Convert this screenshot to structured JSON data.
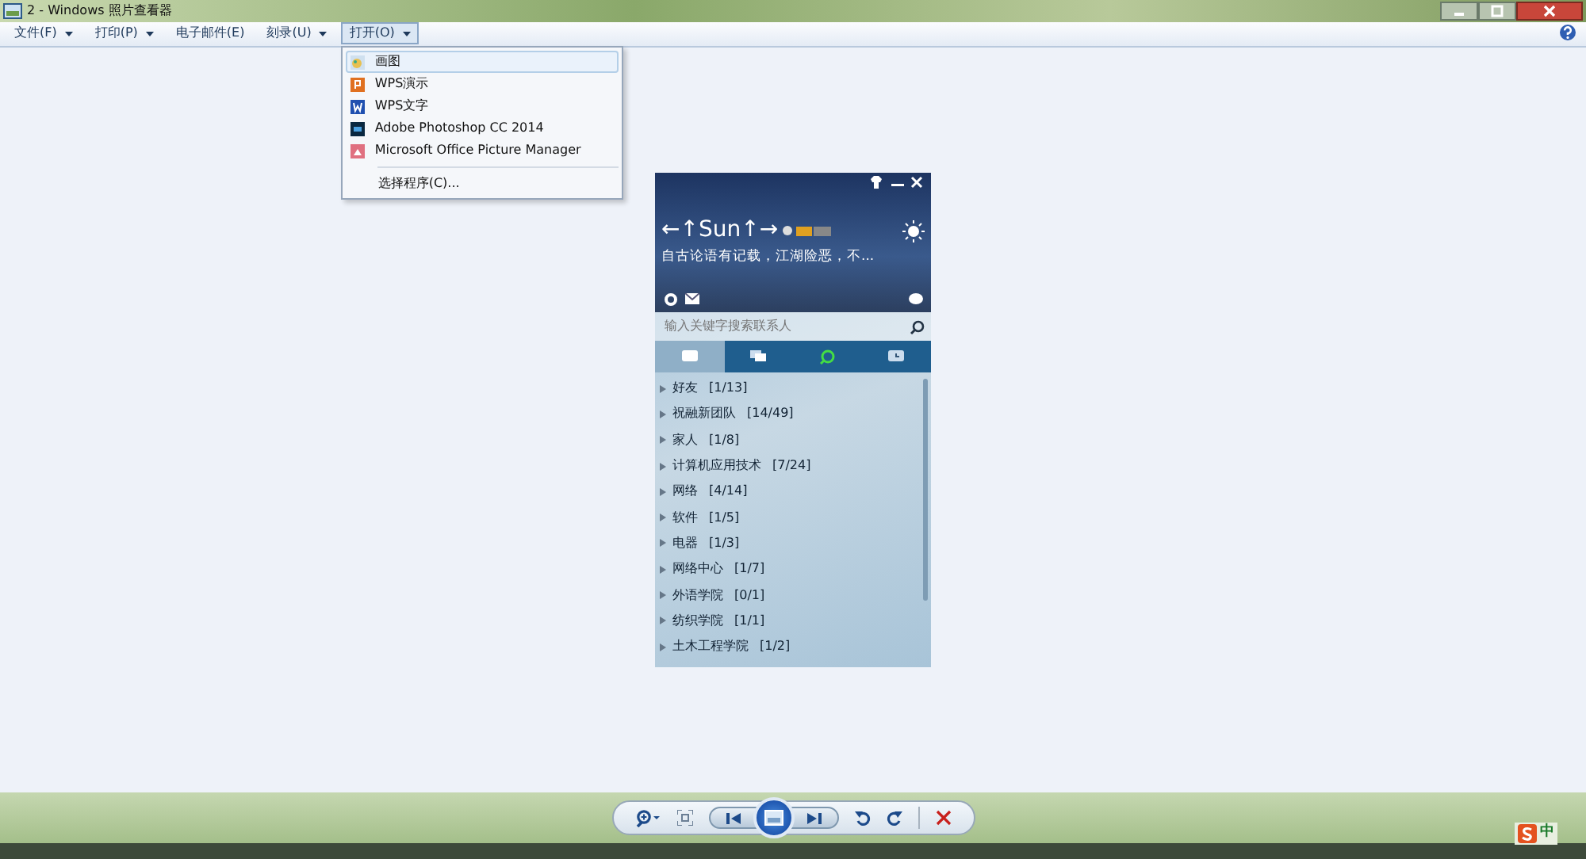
{
  "window": {
    "title": "2 - Windows 照片查看器"
  },
  "menu": [
    {
      "label": "文件(F)",
      "has_arrow": true,
      "open": false
    },
    {
      "label": "打印(P)",
      "has_arrow": true,
      "open": false
    },
    {
      "label": "电子邮件(E)",
      "has_arrow": false,
      "open": false
    },
    {
      "label": "刻录(U)",
      "has_arrow": true,
      "open": false
    },
    {
      "label": "打开(O)",
      "has_arrow": true,
      "open": true
    }
  ],
  "open_menu": {
    "items": [
      {
        "label": "画图",
        "kind": "paint",
        "selected": true
      },
      {
        "label": "WPS演示",
        "kind": "wps-slides",
        "selected": false
      },
      {
        "label": "WPS文字",
        "kind": "wps-writer",
        "selected": false
      },
      {
        "label": "Adobe Photoshop CC 2014",
        "kind": "photoshop",
        "selected": false
      },
      {
        "label": "Microsoft Office Picture Manager",
        "kind": "picture-manager",
        "selected": false
      }
    ],
    "choose": "选择程序(C)..."
  },
  "photo": {
    "nickname": "←↑Sun↑→",
    "signature": "自古论语有记载，江湖险恶，不...",
    "search": {
      "placeholder": "输入关键字搜索联系人"
    },
    "tabs": [
      {
        "kind": "chat",
        "selected": true
      },
      {
        "kind": "contacts",
        "selected": false
      },
      {
        "kind": "space",
        "selected": false
      },
      {
        "kind": "recent",
        "selected": false
      }
    ],
    "groups": [
      {
        "name": "好友",
        "count": "[1/13]",
        "expanded": false
      },
      {
        "name": "祝融新团队",
        "count": "[14/49]",
        "expanded": false
      },
      {
        "name": "家人",
        "count": "[1/8]",
        "expanded": false
      },
      {
        "name": "计算机应用技术",
        "count": "[7/24]",
        "expanded": false
      },
      {
        "name": "网络",
        "count": "[4/14]",
        "expanded": false
      },
      {
        "name": "软件",
        "count": "[1/5]",
        "expanded": false
      },
      {
        "name": "电器",
        "count": "[1/3]",
        "expanded": false
      },
      {
        "name": "网络中心",
        "count": "[1/7]",
        "expanded": false
      },
      {
        "name": "外语学院",
        "count": "[0/1]",
        "expanded": false
      },
      {
        "name": "纺织学院",
        "count": "[1/1]",
        "expanded": false
      },
      {
        "name": "土木工程学院",
        "count": "[1/2]",
        "expanded": false
      }
    ]
  },
  "ime": {
    "label": "中"
  }
}
